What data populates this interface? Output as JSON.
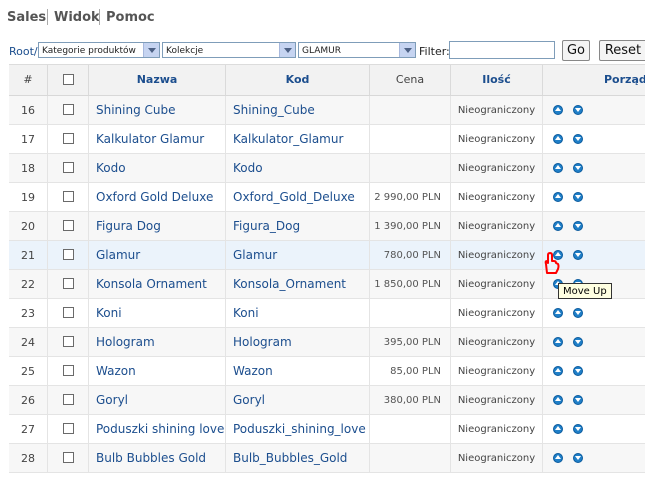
{
  "menu": {
    "items": [
      "Sales",
      "Widok",
      "Pomoc"
    ]
  },
  "toolbar": {
    "breadcrumb": "Root/",
    "category_select": "Kategorie produktów",
    "collection_select": "Kolekcje",
    "subcollection_select": "GLAMUR",
    "filter_label": "Filter:",
    "filter_value": "",
    "go_label": "Go",
    "reset_label": "Reset"
  },
  "table": {
    "headers": {
      "index": "#",
      "name": "Nazwa",
      "code": "Kod",
      "price": "Cena",
      "qty": "Ilość",
      "order": "Porządek"
    },
    "rows": [
      {
        "num": "16",
        "name": "Shining Cube",
        "code": "Shining_Cube",
        "price": "",
        "qty": "Nieograniczony"
      },
      {
        "num": "17",
        "name": "Kalkulator Glamur",
        "code": "Kalkulator_Glamur",
        "price": "",
        "qty": "Nieograniczony"
      },
      {
        "num": "18",
        "name": "Kodo",
        "code": "Kodo",
        "price": "",
        "qty": "Nieograniczony"
      },
      {
        "num": "19",
        "name": "Oxford Gold Deluxe",
        "code": "Oxford_Gold_Deluxe",
        "price": "2 990,00 PLN",
        "qty": "Nieograniczony"
      },
      {
        "num": "20",
        "name": "Figura Dog",
        "code": "Figura_Dog",
        "price": "1 390,00 PLN",
        "qty": "Nieograniczony"
      },
      {
        "num": "21",
        "name": "Glamur",
        "code": "Glamur",
        "price": "780,00 PLN",
        "qty": "Nieograniczony"
      },
      {
        "num": "22",
        "name": "Konsola Ornament",
        "code": "Konsola_Ornament",
        "price": "1 850,00 PLN",
        "qty": "Nieograniczony"
      },
      {
        "num": "23",
        "name": "Koni",
        "code": "Koni",
        "price": "",
        "qty": "Nieograniczony"
      },
      {
        "num": "24",
        "name": "Hologram",
        "code": "Hologram",
        "price": "395,00 PLN",
        "qty": "Nieograniczony"
      },
      {
        "num": "25",
        "name": "Wazon",
        "code": "Wazon",
        "price": "85,00 PLN",
        "qty": "Nieograniczony"
      },
      {
        "num": "26",
        "name": "Goryl",
        "code": "Goryl",
        "price": "380,00 PLN",
        "qty": "Nieograniczony"
      },
      {
        "num": "27",
        "name": "Poduszki shining love",
        "code": "Poduszki_shining_love",
        "price": "",
        "qty": "Nieograniczony"
      },
      {
        "num": "28",
        "name": "Bulb Bubbles Gold",
        "code": "Bulb_Bubbles_Gold",
        "price": "",
        "qty": "Nieograniczony"
      }
    ]
  },
  "tooltip": {
    "text": "Move Up"
  },
  "icons": {
    "move_up": "arrow-up-circle-icon",
    "move_down": "arrow-down-circle-icon",
    "cursor": "hand-pointer-icon"
  },
  "colors": {
    "link": "#1c4e8e",
    "arrow_button": "#1f7fc8",
    "row_highlight": "#ebf3fb",
    "tooltip_bg": "#ffffe1",
    "cursor": "#ff0000"
  }
}
